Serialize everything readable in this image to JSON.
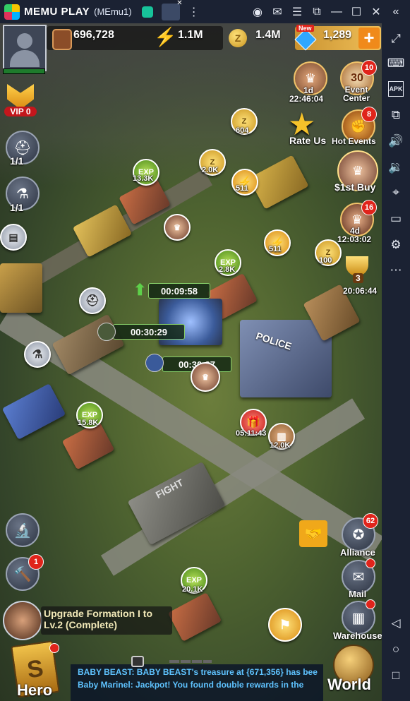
{
  "emulator": {
    "title": "MEMU PLAY",
    "instance": "(MEmu1)",
    "controls": [
      "profile-icon",
      "mail-icon",
      "menu-icon",
      "screenshot-icon",
      "minimize-icon",
      "maximize-icon",
      "close-icon"
    ]
  },
  "sidebar": {
    "icons": [
      "expand-icon",
      "fullscreen-icon",
      "apk-icon",
      "multi-window-icon",
      "volume-up-icon",
      "volume-down-icon",
      "location-icon",
      "folder-icon",
      "settings-icon",
      "more-icon",
      "back-icon",
      "home-icon",
      "recents-icon"
    ],
    "apk_label": "APK"
  },
  "hud": {
    "power": "696,728",
    "energy": "1.1M",
    "coins": "1.4M",
    "diamonds": "1,289",
    "new_badge": "New",
    "vip": "VIP 0",
    "helmet_count": "1/1",
    "flask_count": "1/1"
  },
  "events": {
    "event_timer_day": "1d",
    "event_timer": "22:46:04",
    "event_center_label": "Event Center",
    "event_center_day": "30",
    "event_center_badge": "10",
    "rate_us": "Rate Us",
    "hot_events": "Hot Events",
    "hot_events_badge": "8",
    "first_buy": "1st Buy",
    "first_buy_prefix": "$",
    "timer2_day": "4d",
    "timer2": "12:03:02",
    "timer2_badge": "16",
    "trophy_rank": "3",
    "trophy_timer": "20:06:44"
  },
  "map": {
    "coin_pin_1": "604",
    "exp_1": "13.3K",
    "coin_pin_2": "2.0K",
    "energy_pin_1": "511",
    "energy_pin_2": "511",
    "exp_2": "2.8K",
    "coin_pin_3": "100",
    "upgrade_timer": "00:09:58",
    "train_timer": "00:30:29",
    "hero_timer": "00:30:37",
    "exp_3": "15.8K",
    "box_timer": "05:11:43",
    "wood_pin": "12.0K",
    "exp_4": "20.1K",
    "exp_label": "EXP",
    "police_sign": "POLICE",
    "fight_sign": "FIGHT"
  },
  "right_menu": {
    "alliance": "Alliance",
    "alliance_badge": "62",
    "mail": "Mail",
    "warehouse": "Warehouse"
  },
  "left_tools": {
    "build_badge": "1"
  },
  "quest": {
    "text_line1": "Upgrade Formation I to",
    "text_line2": "Lv.2 (Complete)"
  },
  "bottom": {
    "hero": "Hero",
    "world": "World",
    "chat_line1": "BABY BEAST: BABY BEAST's treasure at {671,356} has bee",
    "chat_line2": "Baby Marinel: Jackpot! You found double rewards in the"
  },
  "colors": {
    "accent_gold": "#f0b429",
    "badge_red": "#e0241b",
    "chat_text": "#5fc3ff",
    "emulator_bar": "#1b2233"
  }
}
